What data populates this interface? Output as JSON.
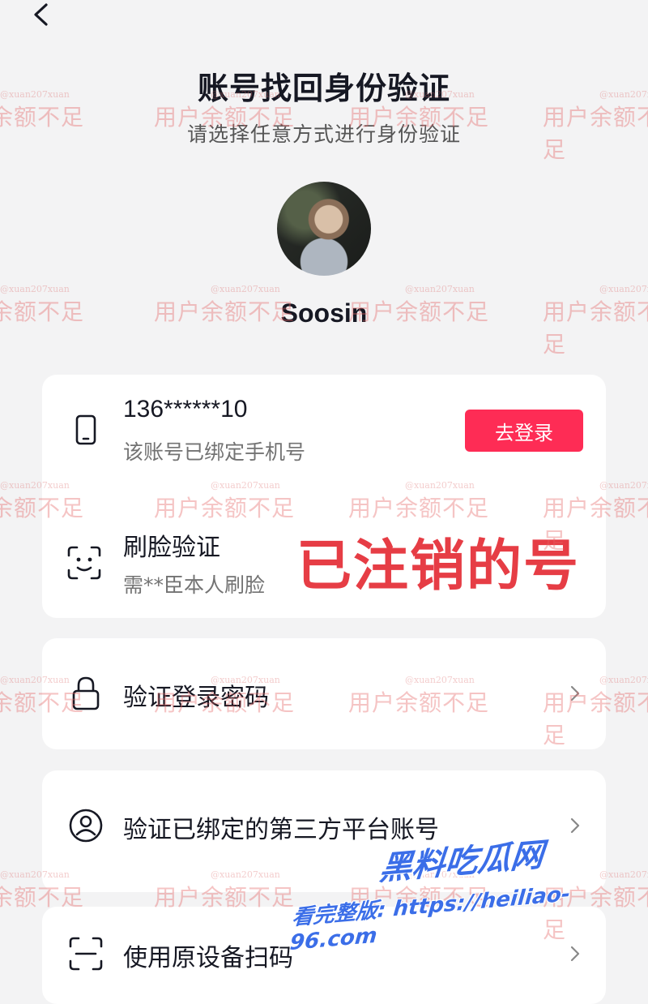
{
  "header": {
    "back_icon": "back-arrow-icon",
    "title": "账号找回身份验证",
    "subtitle": "请选择任意方式进行身份验证"
  },
  "profile": {
    "username": "Soosin"
  },
  "options": {
    "phone": {
      "icon": "phone-icon",
      "title": "136******10",
      "desc": "该账号已绑定手机号",
      "button": "去登录"
    },
    "face": {
      "icon": "face-scan-icon",
      "title": "刷脸验证",
      "desc": "需**臣本人刷脸"
    },
    "password": {
      "icon": "lock-icon",
      "title": "验证登录密码"
    },
    "third_party": {
      "icon": "user-circle-icon",
      "title": "验证已绑定的第三方平台账号"
    },
    "scan": {
      "icon": "scan-icon",
      "title": "使用原设备扫码"
    }
  },
  "overlay": {
    "stamp": "已注销的号",
    "watermark_handle": "@xuan207xuan",
    "watermark_text": "用户余额不足",
    "promo_title": "黑料吃瓜网",
    "promo_url": "看完整版: https://heiliao-96.com"
  },
  "colors": {
    "accent": "#fe2c55",
    "stamp": "#e63d45",
    "promo": "#3b6ee8"
  }
}
